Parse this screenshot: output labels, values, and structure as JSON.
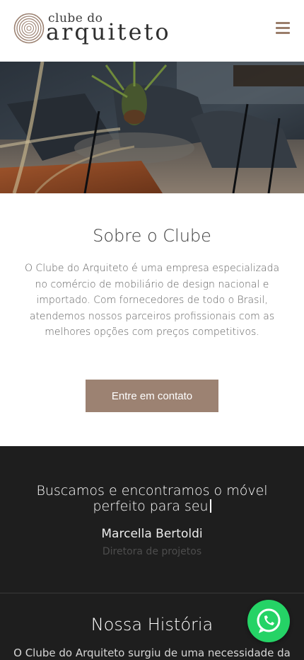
{
  "header": {
    "logo_small": "clube do",
    "logo_big": "arquiteto",
    "menu_icon": "hamburger-menu-icon",
    "menu_color": "#9a7d6a"
  },
  "hero": {
    "image": "interior-lounge-chairs-photo"
  },
  "about": {
    "title": "Sobre o Clube",
    "text": "O Clube do Arquiteto é uma empresa especializada no comércio de mobiliário de design nacional e importado. Com fornecedores de todo o Brasil, atendemos nossos parceiros profissionais com as melhores opções com preços competitivos.",
    "cta_label": "Entre em contato",
    "cta_color": "#9c8272"
  },
  "quote": {
    "headline": "Buscamos e encontramos o móvel perfeito para seu",
    "name": "Marcella Bertoldi",
    "role": "Diretora de projetos"
  },
  "history": {
    "title": "Nossa História",
    "text": "O Clube do Arquiteto surgiu de uma necessidade da"
  },
  "whatsapp": {
    "icon": "whatsapp-icon",
    "color": "#25d366"
  }
}
